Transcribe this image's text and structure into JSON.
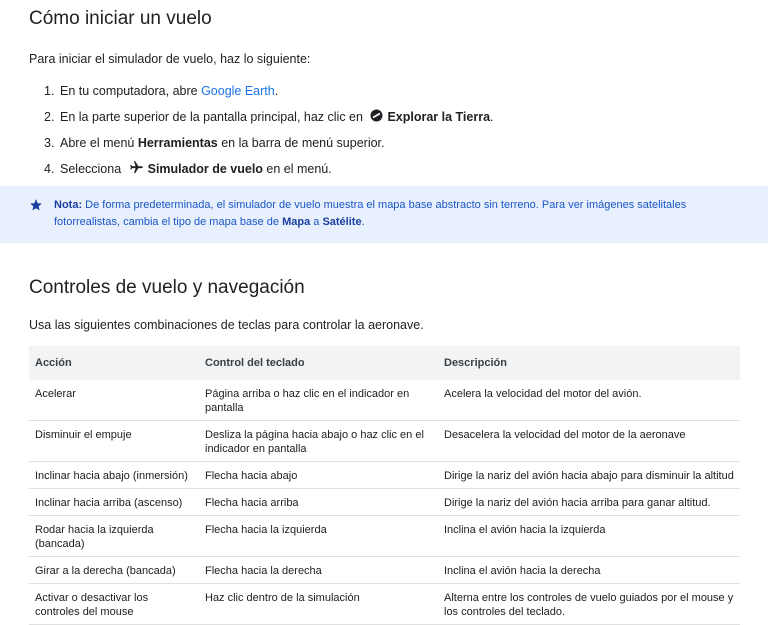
{
  "section1": {
    "title": "Cómo iniciar un vuelo",
    "intro": "Para iniciar el simulador de vuelo, haz lo siguiente:",
    "steps": [
      {
        "num": "1.",
        "pre": "En tu computadora, abre ",
        "link": "Google Earth",
        "post": "."
      },
      {
        "num": "2.",
        "pre": "En la parte superior de la pantalla principal, haz clic en ",
        "bold": "Explorar la Tierra",
        "post": "."
      },
      {
        "num": "3.",
        "pre": "Abre el menú ",
        "bold": "Herramientas",
        "post": " en la barra de menú superior."
      },
      {
        "num": "4.",
        "pre": "Selecciona ",
        "bold": "Simulador de vuelo",
        "post": " en el menú."
      }
    ]
  },
  "note": {
    "label": "Nota:",
    "text1": " De forma predeterminada, el simulador de vuelo muestra el mapa base abstracto sin terreno. Para ver imágenes satelitales fotorrealistas, cambia el tipo de mapa base de ",
    "b1": "Mapa",
    "mid": " a ",
    "b2": "Satélite",
    "end": "."
  },
  "section2": {
    "title": "Controles de vuelo y navegación",
    "intro": "Usa las siguientes combinaciones de teclas para controlar la aeronave.",
    "headers": [
      "Acción",
      "Control del teclado",
      "Descripción"
    ],
    "rows": [
      [
        "Acelerar",
        "Página arriba o haz clic en el indicador en pantalla",
        "Acelera la velocidad del motor del avión."
      ],
      [
        "Disminuir el empuje",
        "Desliza la página hacia abajo o haz clic en el indicador en pantalla",
        "Desacelera la velocidad del motor de la aeronave"
      ],
      [
        "Inclinar hacia abajo (inmersión)",
        "Flecha hacia abajo",
        "Dirige la nariz del avión hacia abajo para disminuir la altitud"
      ],
      [
        "Inclinar hacia arriba (ascenso)",
        "Flecha hacia arriba",
        "Dirige la nariz del avión hacia arriba para ganar altitud."
      ],
      [
        "Rodar hacia la izquierda (bancada)",
        "Flecha hacia la izquierda",
        "Inclina el avión hacia la izquierda"
      ],
      [
        "Girar a la derecha (bancada)",
        "Flecha hacia la derecha",
        "Inclina el avión hacia la derecha"
      ],
      [
        "Activar o desactivar los controles del mouse",
        "Haz clic dentro de la simulación",
        "Alterna entre los controles de vuelo guiados por el mouse y los controles del teclado."
      ]
    ]
  }
}
